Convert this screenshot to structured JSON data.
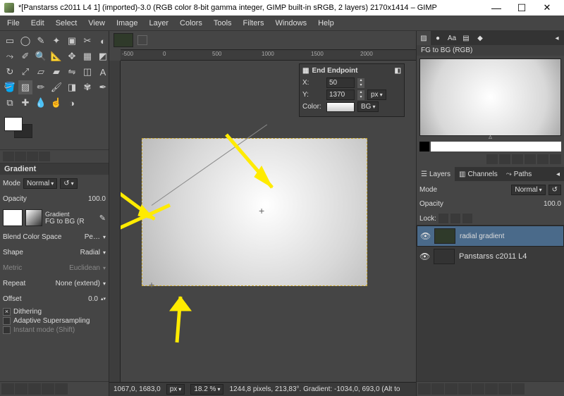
{
  "window": {
    "title": "*[Panstarss c2011 L4 1] (imported)-3.0 (RGB color 8-bit gamma integer, GIMP built-in sRGB, 2 layers) 2170x1414 – GIMP",
    "min": "—",
    "max": "☐",
    "close": "✕"
  },
  "menu": [
    "File",
    "Edit",
    "Select",
    "View",
    "Image",
    "Layer",
    "Colors",
    "Tools",
    "Filters",
    "Windows",
    "Help"
  ],
  "toolopts": {
    "heading": "Gradient",
    "mode_label": "Mode",
    "mode_value": "Normal",
    "opacity_label": "Opacity",
    "opacity_value": "100.0",
    "grad_label": "Gradient",
    "grad_name": "FG to BG (R",
    "blend_label": "Blend Color Space",
    "blend_value": "Pe…",
    "shape_label": "Shape",
    "shape_value": "Radial",
    "metric_label": "Metric",
    "metric_value": "Euclidean",
    "repeat_label": "Repeat",
    "repeat_value": "None (extend)",
    "offset_label": "Offset",
    "offset_value": "0.0",
    "dither": "Dithering",
    "supersample": "Adaptive Supersampling",
    "instant": "Instant mode  (Shift)"
  },
  "ruler": {
    "m500": "-500",
    "p0": "0",
    "p500": "500",
    "p1000": "1000",
    "p1500": "1500",
    "p2000": "2000"
  },
  "endpoint": {
    "title": "End Endpoint",
    "x_label": "X:",
    "x_value": "50",
    "y_label": "Y:",
    "y_value": "1370",
    "unit": "px",
    "color_label": "Color:",
    "color_src": "BG"
  },
  "status": {
    "coords": "1067,0, 1683,0",
    "unit": "px",
    "zoom": "18.2 %",
    "msg": "1244,8 pixels, 213,83°. Gradient: -1034,0, 693,0 (Alt to"
  },
  "right": {
    "fgbg_title": "FG to BG (RGB)",
    "tabs": {
      "layers": "Layers",
      "channels": "Channels",
      "paths": "Paths"
    },
    "mode_label": "Mode",
    "mode_value": "Normal",
    "opacity_label": "Opacity",
    "opacity_value": "100.0",
    "lock_label": "Lock:",
    "layer1": "radial gradient",
    "layer2": "Panstarss c2011 L4"
  }
}
